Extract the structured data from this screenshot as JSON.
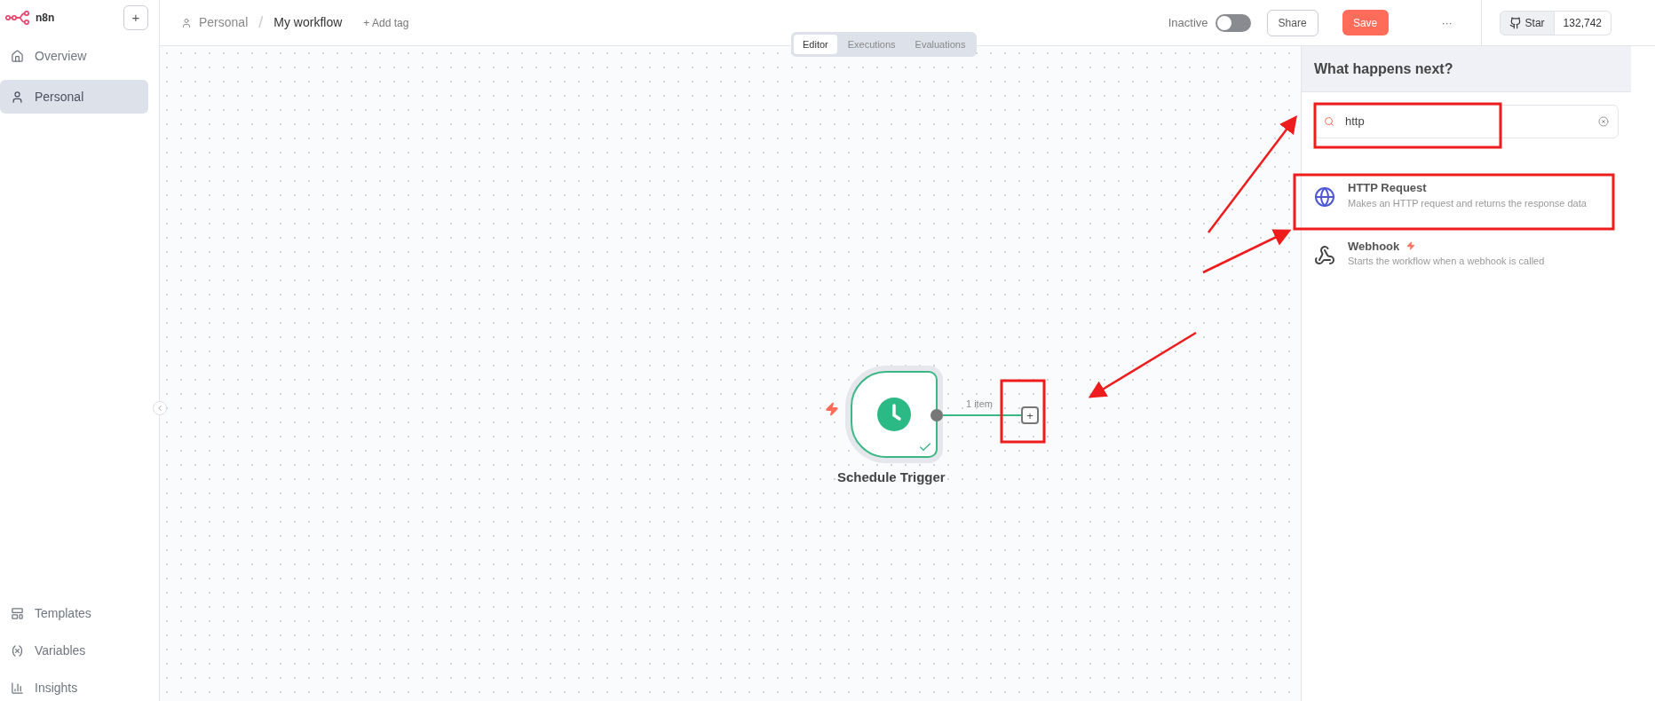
{
  "sidebar": {
    "logo": "n8n",
    "add_button": "+",
    "items": [
      {
        "label": "Overview",
        "selected": false
      },
      {
        "label": "Personal",
        "selected": true
      }
    ],
    "bottom_items": [
      {
        "label": "Templates"
      },
      {
        "label": "Variables"
      },
      {
        "label": "Insights"
      }
    ]
  },
  "header": {
    "breadcrumb": "Personal",
    "separator": "/",
    "workflow_name": "My workflow",
    "add_tag": "+ Add tag",
    "status_label": "Inactive",
    "active": false,
    "share": "Share",
    "save": "Save",
    "more": "···",
    "github": {
      "label": "Star",
      "count": "132,742"
    }
  },
  "tabs": [
    {
      "label": "Editor",
      "selected": true
    },
    {
      "label": "Executions",
      "selected": false
    },
    {
      "label": "Evaluations",
      "selected": false
    }
  ],
  "canvas": {
    "node": {
      "title": "Schedule Trigger",
      "trigger": true,
      "success": true
    },
    "connection_label": "1 item",
    "add_button": "+"
  },
  "panel": {
    "title": "What happens next?",
    "search": {
      "value": "http"
    },
    "results": [
      {
        "title": "HTTP Request",
        "description": "Makes an HTTP request and returns the response data",
        "trigger": false
      },
      {
        "title": "Webhook",
        "description": "Starts the workflow when a webhook is called",
        "trigger": true
      }
    ]
  }
}
